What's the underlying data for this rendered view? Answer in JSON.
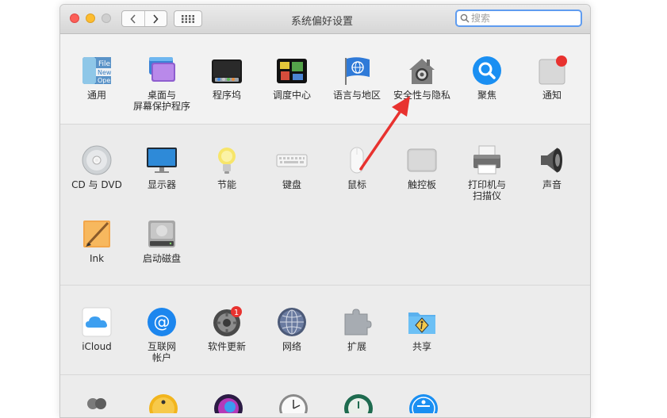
{
  "window": {
    "title": "系统偏好设置"
  },
  "search": {
    "placeholder": "搜索"
  },
  "rows": {
    "personal": [
      {
        "label": "通用"
      },
      {
        "label": "桌面与",
        "label2": "屏幕保护程序"
      },
      {
        "label": "程序坞"
      },
      {
        "label": "调度中心"
      },
      {
        "label": "语言与地区"
      },
      {
        "label": "安全性与隐私"
      },
      {
        "label": "聚焦"
      },
      {
        "label": "通知"
      }
    ],
    "hardware": [
      {
        "label": "CD 与 DVD"
      },
      {
        "label": "显示器"
      },
      {
        "label": "节能"
      },
      {
        "label": "键盘"
      },
      {
        "label": "鼠标"
      },
      {
        "label": "触控板"
      },
      {
        "label": "打印机与",
        "label2": "扫描仪"
      },
      {
        "label": "声音"
      },
      {
        "label": "Ink"
      },
      {
        "label": "启动磁盘"
      }
    ],
    "internet": [
      {
        "label": "iCloud"
      },
      {
        "label": "互联网",
        "label2": "帐户"
      },
      {
        "label": "软件更新",
        "badge": "1"
      },
      {
        "label": "网络"
      },
      {
        "label": "扩展"
      },
      {
        "label": "共享"
      }
    ]
  },
  "general_icon_text": {
    "line1": "File",
    "line2": "New",
    "line3": "Ope"
  },
  "colors": {
    "annotation_arrow": "#e8322f",
    "search_focus": "#5f9cf0",
    "badge": "#e8322f"
  }
}
